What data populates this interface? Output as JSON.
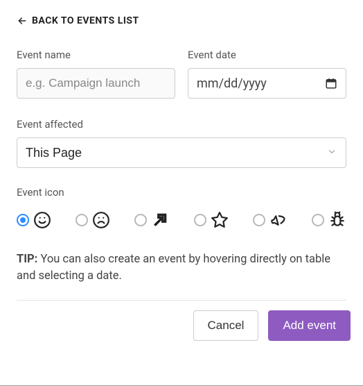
{
  "back": {
    "label": "BACK TO EVENTS LIST"
  },
  "fields": {
    "name": {
      "label": "Event name",
      "placeholder": "e.g. Campaign launch",
      "value": ""
    },
    "date": {
      "label": "Event date",
      "placeholder": "mm/dd/yyyy",
      "value": ""
    },
    "affected": {
      "label": "Event affected",
      "value": "This Page"
    },
    "icon": {
      "label": "Event icon",
      "selected_index": 0,
      "options": [
        "smile",
        "frown",
        "external-arrow",
        "star",
        "megaphone",
        "bug"
      ]
    }
  },
  "tip": {
    "label": "TIP:",
    "text": "You can also create an event by hovering directly on table and selecting a date."
  },
  "buttons": {
    "cancel": "Cancel",
    "submit": "Add event"
  }
}
